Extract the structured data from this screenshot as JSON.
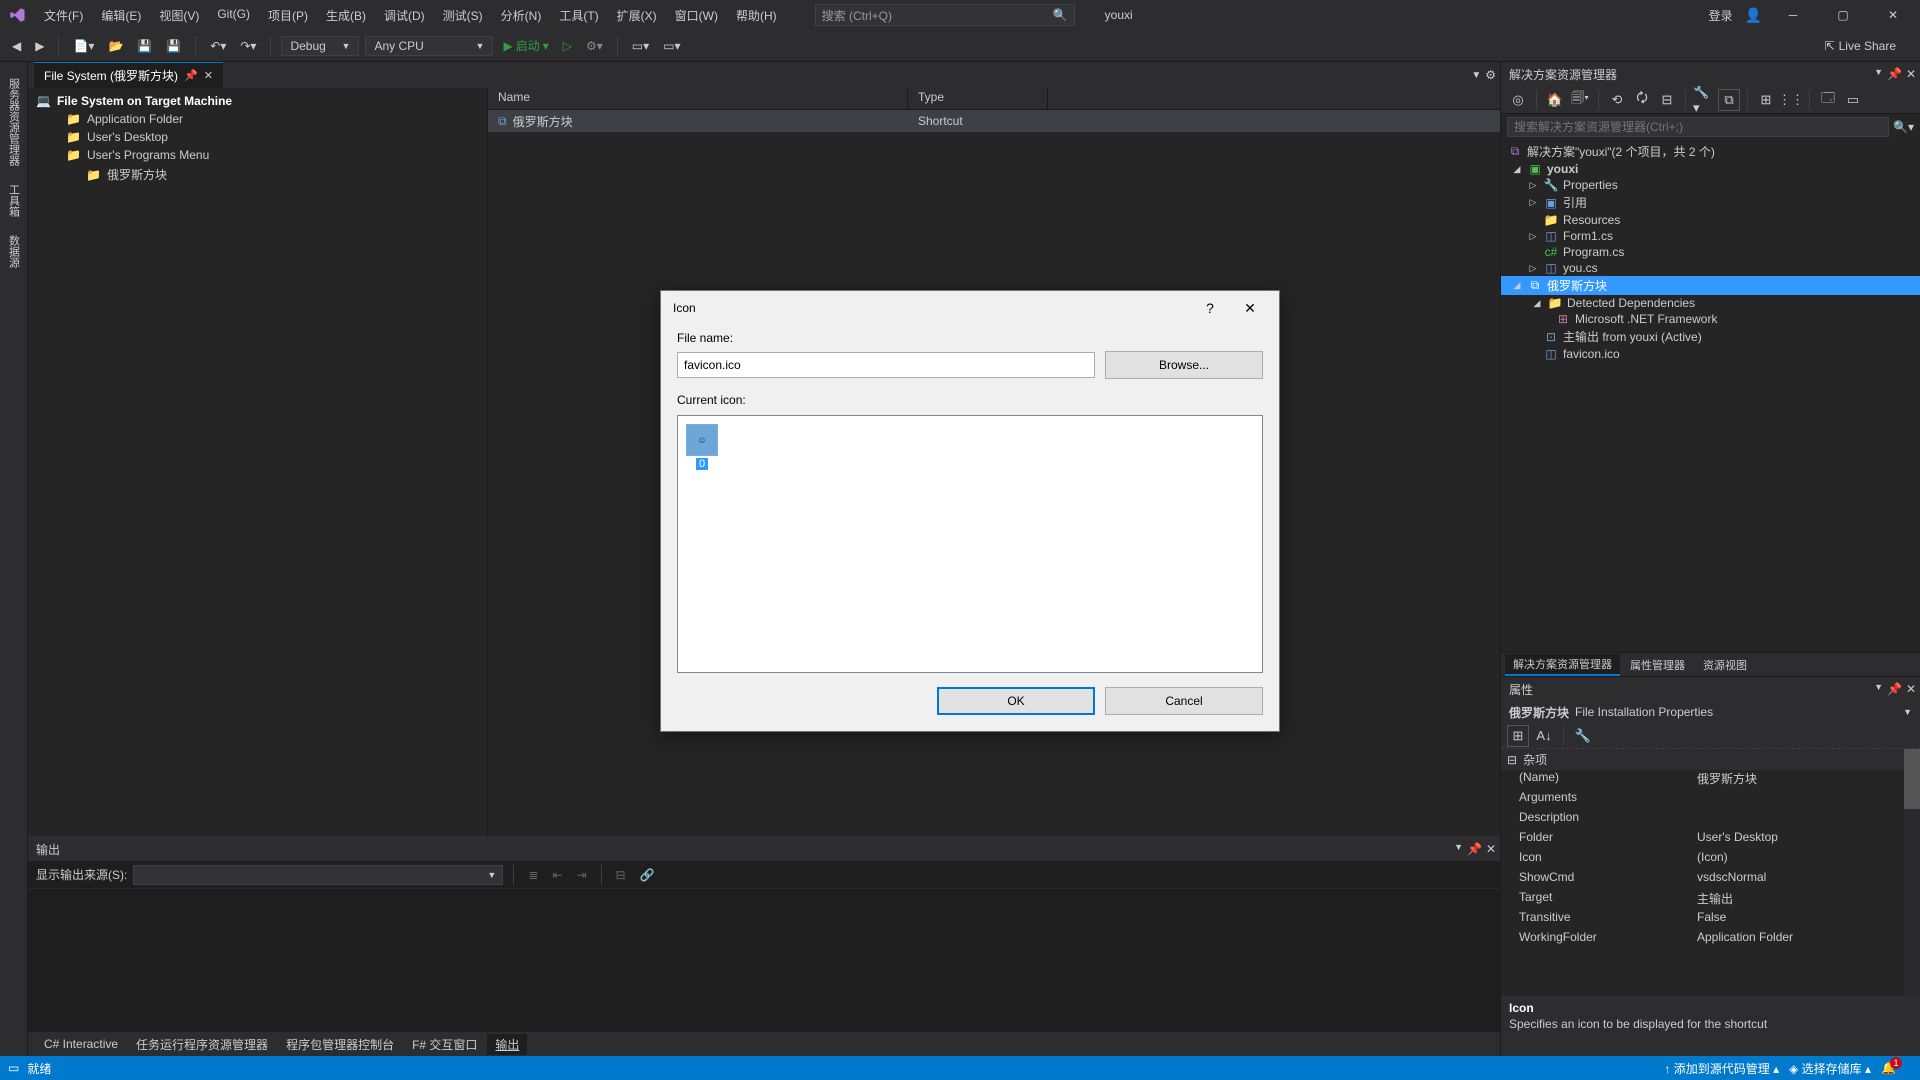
{
  "titlebar": {
    "menu": [
      "文件(F)",
      "编辑(E)",
      "视图(V)",
      "Git(G)",
      "项目(P)",
      "生成(B)",
      "调试(D)",
      "测试(S)",
      "分析(N)",
      "工具(T)",
      "扩展(X)",
      "窗口(W)",
      "帮助(H)"
    ],
    "search_placeholder": "搜索 (Ctrl+Q)",
    "project": "youxi",
    "login": "登录"
  },
  "toolbar": {
    "config": "Debug",
    "platform": "Any CPU",
    "start": "启动",
    "liveshare": "Live Share"
  },
  "doc_tab": {
    "title": "File System (俄罗斯方块)"
  },
  "left_tabs": [
    "服务器资源管理器",
    "工具箱",
    "数据源"
  ],
  "fs_tree": {
    "root": "File System on Target Machine",
    "items": [
      "Application Folder",
      "User's Desktop",
      "User's Programs Menu"
    ],
    "sub": "俄罗斯方块"
  },
  "fs_list": {
    "cols": {
      "name": "Name",
      "type": "Type"
    },
    "row": {
      "name": "俄罗斯方块",
      "type": "Shortcut"
    }
  },
  "output": {
    "title": "输出",
    "source_label": "显示输出来源(S):"
  },
  "bottom_tabs": [
    "C# Interactive",
    "任务运行程序资源管理器",
    "程序包管理器控制台",
    "F# 交互窗口",
    "输出"
  ],
  "solution": {
    "title": "解决方案资源管理器",
    "search_ph": "搜索解决方案资源管理器(Ctrl+;)",
    "root": "解决方案\"youxi\"(2 个项目，共 2 个)",
    "proj1": "youxi",
    "proj1_items": [
      "Properties",
      "引用",
      "Resources",
      "Form1.cs",
      "Program.cs",
      "you.cs"
    ],
    "proj2": "俄罗斯方块",
    "proj2_detected": "Detected Dependencies",
    "proj2_net": "Microsoft .NET Framework",
    "proj2_mainout": "主输出 from youxi (Active)",
    "proj2_favicon": "favicon.ico",
    "tabs": [
      "解决方案资源管理器",
      "属性管理器",
      "资源视图"
    ]
  },
  "props": {
    "title": "属性",
    "obj_name": "俄罗斯方块",
    "obj_type": "File Installation Properties",
    "category": "杂项",
    "rows": [
      {
        "n": "(Name)",
        "v": "俄罗斯方块"
      },
      {
        "n": "Arguments",
        "v": ""
      },
      {
        "n": "Description",
        "v": ""
      },
      {
        "n": "Folder",
        "v": "User's Desktop"
      },
      {
        "n": "Icon",
        "v": "(Icon)"
      },
      {
        "n": "ShowCmd",
        "v": "vsdscNormal"
      },
      {
        "n": "Target",
        "v": "主输出"
      },
      {
        "n": "Transitive",
        "v": "False"
      },
      {
        "n": "WorkingFolder",
        "v": "Application Folder"
      }
    ],
    "desc_name": "Icon",
    "desc_text": "Specifies an icon to be displayed for the shortcut"
  },
  "status": {
    "ready": "就绪",
    "add_src": "添加到源代码管理",
    "select_repo": "选择存储库"
  },
  "dialog": {
    "title": "Icon",
    "file_label": "File name:",
    "file_value": "favicon.ico",
    "browse": "Browse...",
    "current_label": "Current icon:",
    "icon_index": "0",
    "ok": "OK",
    "cancel": "Cancel"
  }
}
